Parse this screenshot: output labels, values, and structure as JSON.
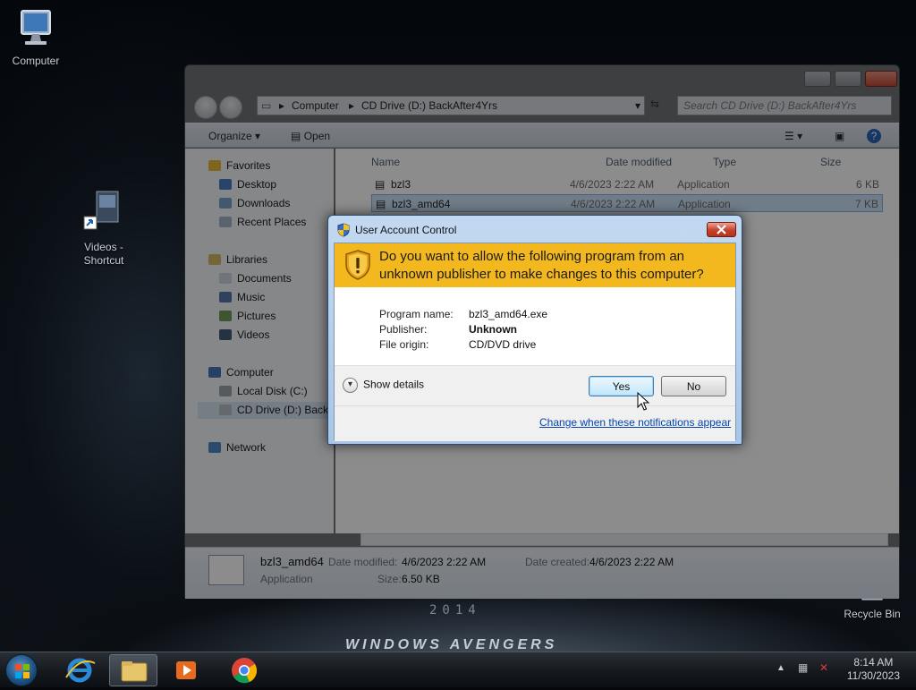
{
  "desktop": {
    "icons": [
      {
        "label": "Computer"
      },
      {
        "label": "Videos - Shortcut"
      },
      {
        "label": "Recycle Bin"
      }
    ],
    "wallpaper": {
      "year": "2014",
      "brand": "WINDOWS AVENGERS"
    }
  },
  "explorer": {
    "address": [
      "Computer",
      "CD Drive (D:) BackAfter4Yrs"
    ],
    "search_placeholder": "Search CD Drive (D:) BackAfter4Yrs",
    "toolbar": {
      "organize": "Organize",
      "open": "Open"
    },
    "nav": {
      "favorites": "Favorites",
      "favorites_items": [
        "Desktop",
        "Downloads",
        "Recent Places"
      ],
      "libraries": "Libraries",
      "libraries_items": [
        "Documents",
        "Music",
        "Pictures",
        "Videos"
      ],
      "computer": "Computer",
      "computer_items": [
        "Local Disk (C:)",
        "CD Drive (D:) BackA"
      ],
      "network": "Network"
    },
    "columns": [
      "Name",
      "Date modified",
      "Type",
      "Size"
    ],
    "files": [
      {
        "name": "bzl3",
        "date": "4/6/2023 2:22 AM",
        "type": "Application",
        "size": "6 KB",
        "selected": false
      },
      {
        "name": "bzl3_amd64",
        "date": "4/6/2023 2:22 AM",
        "type": "Application",
        "size": "7 KB",
        "selected": true
      }
    ],
    "details": {
      "name": "bzl3_amd64",
      "date_modified_label": "Date modified:",
      "date_modified": "4/6/2023 2:22 AM",
      "date_created_label": "Date created:",
      "date_created": "4/6/2023 2:22 AM",
      "type": "Application",
      "size_label": "Size:",
      "size": "6.50 KB"
    }
  },
  "uac": {
    "title": "User Account Control",
    "question": "Do you want to allow the following program from an unknown publisher to make changes to this computer?",
    "fields": [
      {
        "label": "Program name:",
        "value": "bzl3_amd64.exe"
      },
      {
        "label": "Publisher:",
        "value": "Unknown"
      },
      {
        "label": "File origin:",
        "value": "CD/DVD drive"
      }
    ],
    "show_details": "Show details",
    "yes": "Yes",
    "no": "No",
    "link": "Change when these notifications appear",
    "banner_color": "#f3b81d"
  },
  "taskbar": {
    "time": "8:14 AM",
    "date": "11/30/2023"
  }
}
